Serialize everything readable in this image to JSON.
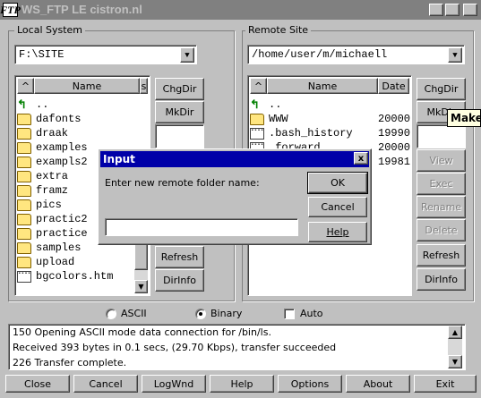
{
  "window": {
    "title": "WS_FTP LE cistron.nl",
    "icon_text": "FTP",
    "minimize_label": "_",
    "maximize_label": "□",
    "close_label": "x"
  },
  "local": {
    "group_label": "Local System",
    "path": "F:\\SITE",
    "sort_label": "^",
    "name_header": "Name",
    "size_header": "s",
    "rows": [
      {
        "icon": "up-arrow-icon",
        "name": ".."
      },
      {
        "icon": "folder-icon",
        "name": "dafonts"
      },
      {
        "icon": "folder-icon",
        "name": "draak"
      },
      {
        "icon": "folder-icon",
        "name": "examples"
      },
      {
        "icon": "folder-icon",
        "name": "exampls2"
      },
      {
        "icon": "folder-icon",
        "name": "extra"
      },
      {
        "icon": "folder-icon",
        "name": "framz"
      },
      {
        "icon": "folder-icon",
        "name": "pics"
      },
      {
        "icon": "folder-icon",
        "name": "practic2"
      },
      {
        "icon": "folder-icon",
        "name": "practice"
      },
      {
        "icon": "folder-icon",
        "name": "samples"
      },
      {
        "icon": "folder-icon",
        "name": "upload"
      },
      {
        "icon": "file-icon",
        "name": "bgcolors.htm"
      }
    ],
    "buttons": {
      "chgdir": "ChgDir",
      "mkdir": "MkDir",
      "refresh": "Refresh",
      "dirinfo": "DirInfo"
    }
  },
  "remote": {
    "group_label": "Remote Site",
    "path": "/home/user/m/michaell",
    "sort_label": "^",
    "name_header": "Name",
    "date_header": "Date",
    "rows": [
      {
        "icon": "up-arrow-icon",
        "name": "..",
        "date": ""
      },
      {
        "icon": "folder-icon",
        "name": "WWW",
        "date": "20000"
      },
      {
        "icon": "file-icon",
        "name": ".bash_history",
        "date": "19990"
      },
      {
        "icon": "file-icon",
        "name": ".forward",
        "date": "20000"
      },
      {
        "icon": "file-icon",
        "name": "",
        "date": "19981"
      }
    ],
    "buttons": {
      "chgdir": "ChgDir",
      "mkdir": "MkDir",
      "view": "View",
      "exec": "Exec",
      "rename": "Rename",
      "delete": "Delete",
      "refresh": "Refresh",
      "dirinfo": "DirInfo"
    },
    "tooltip": "Make"
  },
  "dialog": {
    "title": "Input",
    "close_label": "x",
    "prompt": "Enter new remote folder name:",
    "value": "",
    "ok": "OK",
    "cancel": "Cancel",
    "help": "Help"
  },
  "transfer_mode": {
    "ascii_label": "ASCII",
    "binary_label": "Binary",
    "auto_label": "Auto",
    "selected": "Binary",
    "auto_checked": false
  },
  "log": {
    "lines": [
      "150 Opening ASCII mode data connection for /bin/ls.",
      "Received 393 bytes in 0.1 secs, (29.70 Kbps), transfer succeeded",
      "226 Transfer complete."
    ]
  },
  "bottom_buttons": {
    "close": "Close",
    "cancel": "Cancel",
    "logwnd": "LogWnd",
    "help": "Help",
    "options": "Options",
    "about": "About",
    "exit": "Exit"
  }
}
